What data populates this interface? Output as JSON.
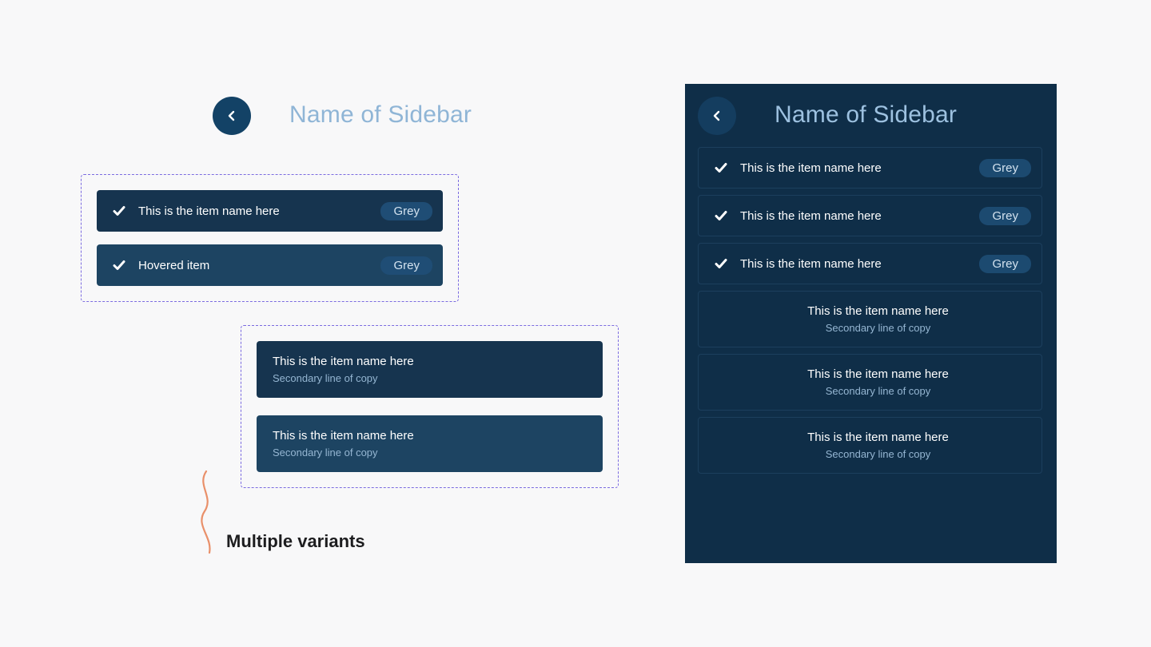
{
  "sidebar_title": "Name of Sidebar",
  "variants_label": "Multiple variants",
  "left": {
    "single_line_items": [
      {
        "label": "This is the item name here",
        "badge": "Grey",
        "state": "default"
      },
      {
        "label": "Hovered item",
        "badge": "Grey",
        "state": "hovered"
      }
    ],
    "two_line_items": [
      {
        "primary": "This is the item name here",
        "secondary": "Secondary line of copy",
        "state": "default"
      },
      {
        "primary": "This is the item name here",
        "secondary": "Secondary line of copy",
        "state": "hovered"
      }
    ]
  },
  "dark_panel": {
    "title": "Name of Sidebar",
    "single_line_items": [
      {
        "label": "This is the item name here",
        "badge": "Grey"
      },
      {
        "label": "This is the item name here",
        "badge": "Grey"
      },
      {
        "label": "This is the item name here",
        "badge": "Grey"
      }
    ],
    "two_line_items": [
      {
        "primary": "This is the item name here",
        "secondary": "Secondary line of copy"
      },
      {
        "primary": "This is the item name here",
        "secondary": "Secondary line of copy"
      },
      {
        "primary": "This is the item name here",
        "secondary": "Secondary line of copy"
      }
    ]
  },
  "icons": {
    "back": "chevron-left-icon",
    "check": "checkmark-icon"
  },
  "colors": {
    "accent_navy": "#134266",
    "panel_bg": "#0f2e48",
    "item_default": "#16344f",
    "item_hover": "#1d4462",
    "title_blue": "#8fb5d6",
    "dashed_outline": "#7b6be0",
    "wave_orange": "#e9906a"
  }
}
